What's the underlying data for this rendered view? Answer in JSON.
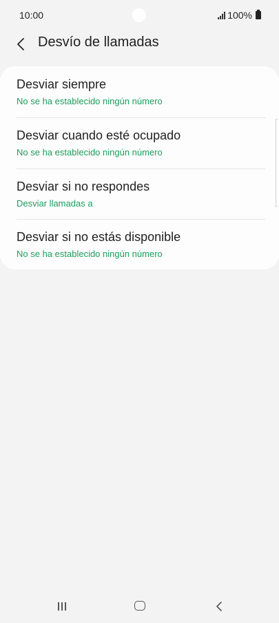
{
  "status_bar": {
    "time": "10:00",
    "battery": "100%",
    "icons": [
      "signal-icon",
      "battery-icon"
    ]
  },
  "header": {
    "title": "Desvío de llamadas",
    "back_icon": "chevron-left-icon"
  },
  "options": [
    {
      "title": "Desviar siempre",
      "subtitle": "No se ha establecido ningún número"
    },
    {
      "title": "Desviar cuando esté ocupado",
      "subtitle": "No se ha establecido ningún número"
    },
    {
      "title": "Desviar si no respondes",
      "subtitle": "Desviar llamadas a"
    },
    {
      "title": "Desviar si no estás disponible",
      "subtitle": "No se ha establecido ningún número"
    }
  ],
  "colors": {
    "accent": "#1a9d5c",
    "background": "#f3f3f3",
    "card": "#fdfdfd"
  },
  "nav_bar": {
    "icons": [
      "recents-icon",
      "home-icon",
      "back-icon"
    ]
  }
}
